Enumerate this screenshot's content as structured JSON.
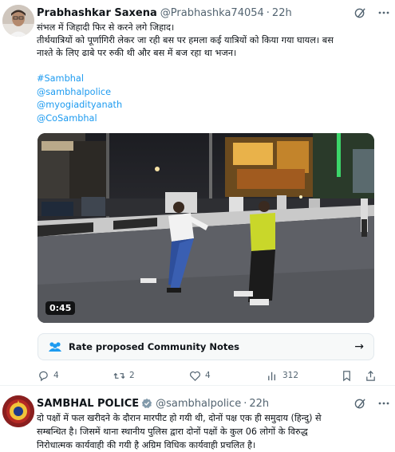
{
  "tweet1": {
    "author_name": "Prabhashkar Saxena",
    "author_handle": "@Prabhashka74054",
    "time": "22h",
    "lines": [
      "संभल में जिहादी फिर से करने लगे जिहाद।",
      "तीर्थयात्रियों को पूर्णागिरी लेकर जा रही बस पर हमला कई यात्रियों को किया गया घायल। बस",
      "नाश्ते के लिए ढाबे पर रुकी थी और बस में बज रहा था भजन।"
    ],
    "tags": [
      "#Sambhal",
      "@sambhalpolice",
      "@myogiadityanath",
      "@CoSambhal"
    ],
    "video_duration": "0:45",
    "community_notes_label": "Rate proposed Community Notes",
    "actions": {
      "replies": "4",
      "reposts": "2",
      "likes": "4",
      "views": "312"
    }
  },
  "tweet2": {
    "author_name": "SAMBHAL POLICE",
    "author_handle": "@sambhalpolice",
    "time": "22h",
    "lines": [
      "दो पक्षों में फल खरीदने के दौरान मारपीट हो गयी थी, दोनों पक्ष एक ही समुदाय (हिन्दु) से",
      "सम्बन्धित है। जिसमें थाना स्थानीय पुलिस द्वारा दोनों पक्षों के कुल 06 लोगों के विरुद्ध",
      "निरोधात्मक कार्यवाही की गयी है अग्रिम विधिक कार्यवाही प्रचलित है।"
    ],
    "verified_color": "#829aab"
  },
  "colors": {
    "link": "#1d9bf0",
    "muted": "#536471",
    "text": "#0f1419"
  }
}
